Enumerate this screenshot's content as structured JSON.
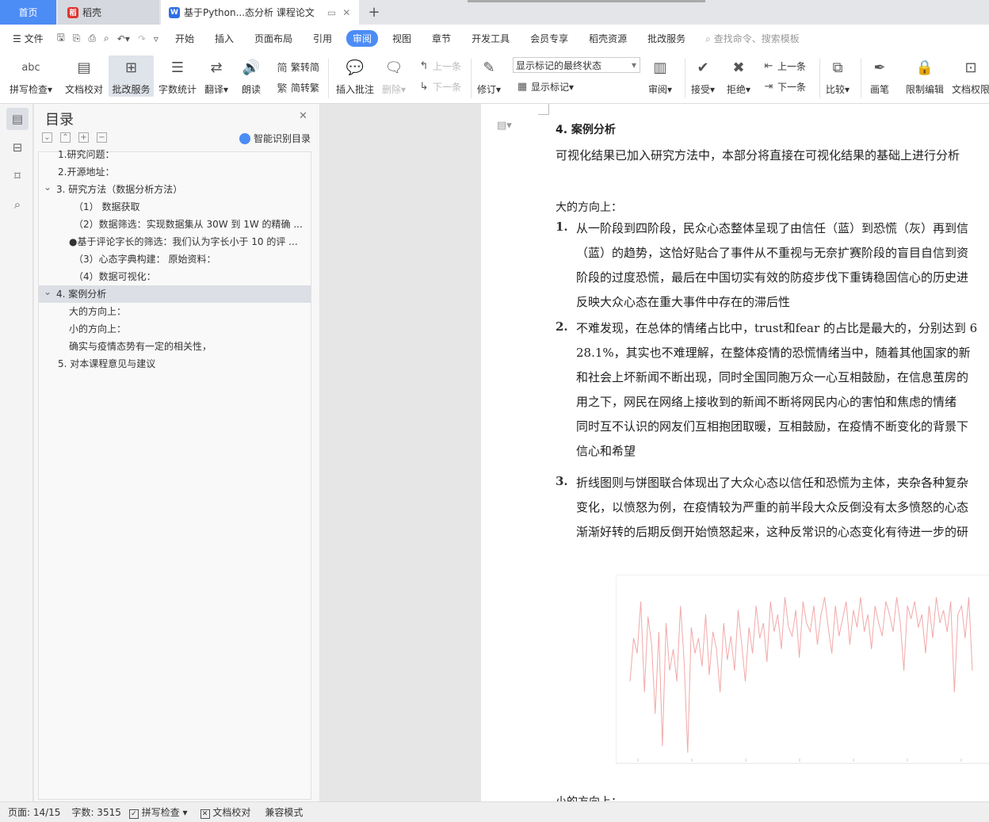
{
  "tabs": {
    "home": "首页",
    "daoke": "稻壳",
    "doc": "基于Python...态分析 课程论文"
  },
  "menu": {
    "file": "文件",
    "items": [
      "开始",
      "插入",
      "页面布局",
      "引用",
      "审阅",
      "视图",
      "章节",
      "开发工具",
      "会员专享",
      "稻壳资源",
      "批改服务"
    ],
    "active": "审阅",
    "search": "查找命令、搜索模板"
  },
  "ribbon": {
    "spell": "拼写检查",
    "proof": "文档校对",
    "review_service": "批改服务",
    "wordcount": "字数统计",
    "translate": "翻译",
    "read": "朗读",
    "trad2simp": "繁转简",
    "simp2trad": "简转繁",
    "insert_comment": "插入批注",
    "delete": "删除",
    "prev": "上一条",
    "next": "下一条",
    "revise": "修订",
    "markup_state": "显示标记的最终状态",
    "show_markup": "显示标记",
    "review": "审阅",
    "accept": "接受",
    "reject": "拒绝",
    "prev2": "上一条",
    "next2": "下一条",
    "compare": "比较",
    "pen": "画笔",
    "restrict": "限制编辑",
    "doc_perm": "文档权限"
  },
  "toc": {
    "title": "目录",
    "smart": "智能识别目录",
    "items": [
      "1.研究问题：",
      "2.开源地址：",
      "3. 研究方法（数据分析方法）",
      "（1） 数据获取",
      "（2）数据筛选：实现数据集从 30W 到 1W 的精确 ...",
      "●基于评论字长的筛选：我们认为字长小于 10 的评 ...",
      "（3）心态字典构建： 原始资料：",
      "（4）数据可视化：",
      "4. 案例分析",
      "大的方向上：",
      "小的方向上：",
      "确实与疫情态势有一定的相关性，",
      "5. 对本课程意见与建议"
    ]
  },
  "doc": {
    "heading": "4. 案例分析",
    "intro": "可视化结果已加入研究方法中，本部分将直接在可视化结果的基础上进行分析",
    "subheading": "大的方向上：",
    "p1": [
      "从一阶段到四阶段，民众心态整体呈现了由信任（蓝）到恐慌（灰）再到信",
      "（蓝）的趋势，这恰好贴合了事件从不重视与无奈扩赛阶段的盲目自信到资",
      "阶段的过度恐慌，最后在中国切实有效的防疫步伐下重铸稳固信心的历史进",
      "反映大众心态在重大事件中存在的滞后性"
    ],
    "p2": [
      "不难发现，在总体的情绪占比中，trust和fear 的占比是最大的，分别达到 6",
      "28.1%，其实也不难理解，在整体疫情的恐慌情绪当中，随着其他国家的新",
      "和社会上坏新闻不断出现，同时全国同胞万众一心互相鼓励，在信息茧房的",
      "用之下，网民在网络上接收到的新闻不断将网民内心的害怕和焦虑的情绪",
      "同时互不认识的网友们互相抱团取暖，互相鼓励，在疫情不断变化的背景下",
      "信心和希望"
    ],
    "p3": [
      "折线图则与饼图联合体现出了大众心态以信任和恐慌为主体，夹杂各种复杂",
      "变化，以愤怒为例，在疫情较为严重的前半段大众反倒没有太多愤怒的心态",
      "渐渐好转的后期反倒开始愤怒起来，这种反常识的心态变化有待进一步的研"
    ],
    "numbers": [
      "1.",
      "2.",
      "3."
    ],
    "next_heading": "小的方向上："
  },
  "chart_data": {
    "type": "line",
    "series": [
      {
        "values": [
          0.35,
          0.55,
          0.48,
          0.72,
          0.3,
          0.65,
          0.52,
          0.2,
          0.58,
          0.05,
          0.62,
          0.4,
          0.5,
          0.35,
          0.7,
          0.45,
          0.02,
          0.6,
          0.48,
          0.55,
          0.42,
          0.66,
          0.38,
          0.58,
          0.5,
          0.3,
          0.62,
          0.45,
          0.56,
          0.4,
          0.68,
          0.52,
          0.35,
          0.6,
          0.48,
          0.7,
          0.55,
          0.62,
          0.44,
          0.72,
          0.58,
          0.66,
          0.5,
          0.74,
          0.6,
          0.56,
          0.68,
          0.46,
          0.72,
          0.62,
          0.58,
          0.7,
          0.52,
          0.66,
          0.74,
          0.6,
          0.48,
          0.7,
          0.56,
          0.64,
          0.72,
          0.52,
          0.68,
          0.6,
          0.74,
          0.58,
          0.66,
          0.5,
          0.7,
          0.62,
          0.56,
          0.72,
          0.66,
          0.58,
          0.74,
          0.62,
          0.4,
          0.7,
          0.64,
          0.72,
          0.6,
          0.66,
          0.48,
          0.7,
          0.55,
          0.74,
          0.62,
          0.68,
          0.58,
          0.72,
          0.3,
          0.66,
          0.7,
          0.55,
          0.74,
          0.4
        ],
        "color": "#f2a8a8"
      }
    ],
    "ylim": [
      0,
      0.8
    ],
    "grid": false
  },
  "status": {
    "page": "页面: 14/15",
    "words": "字数: 3515",
    "spell": "拼写检查",
    "proof": "文档校对",
    "compat": "兼容模式"
  },
  "colors": {
    "accent": "#4c8cf5",
    "chart_line": "#f2a8a8"
  }
}
